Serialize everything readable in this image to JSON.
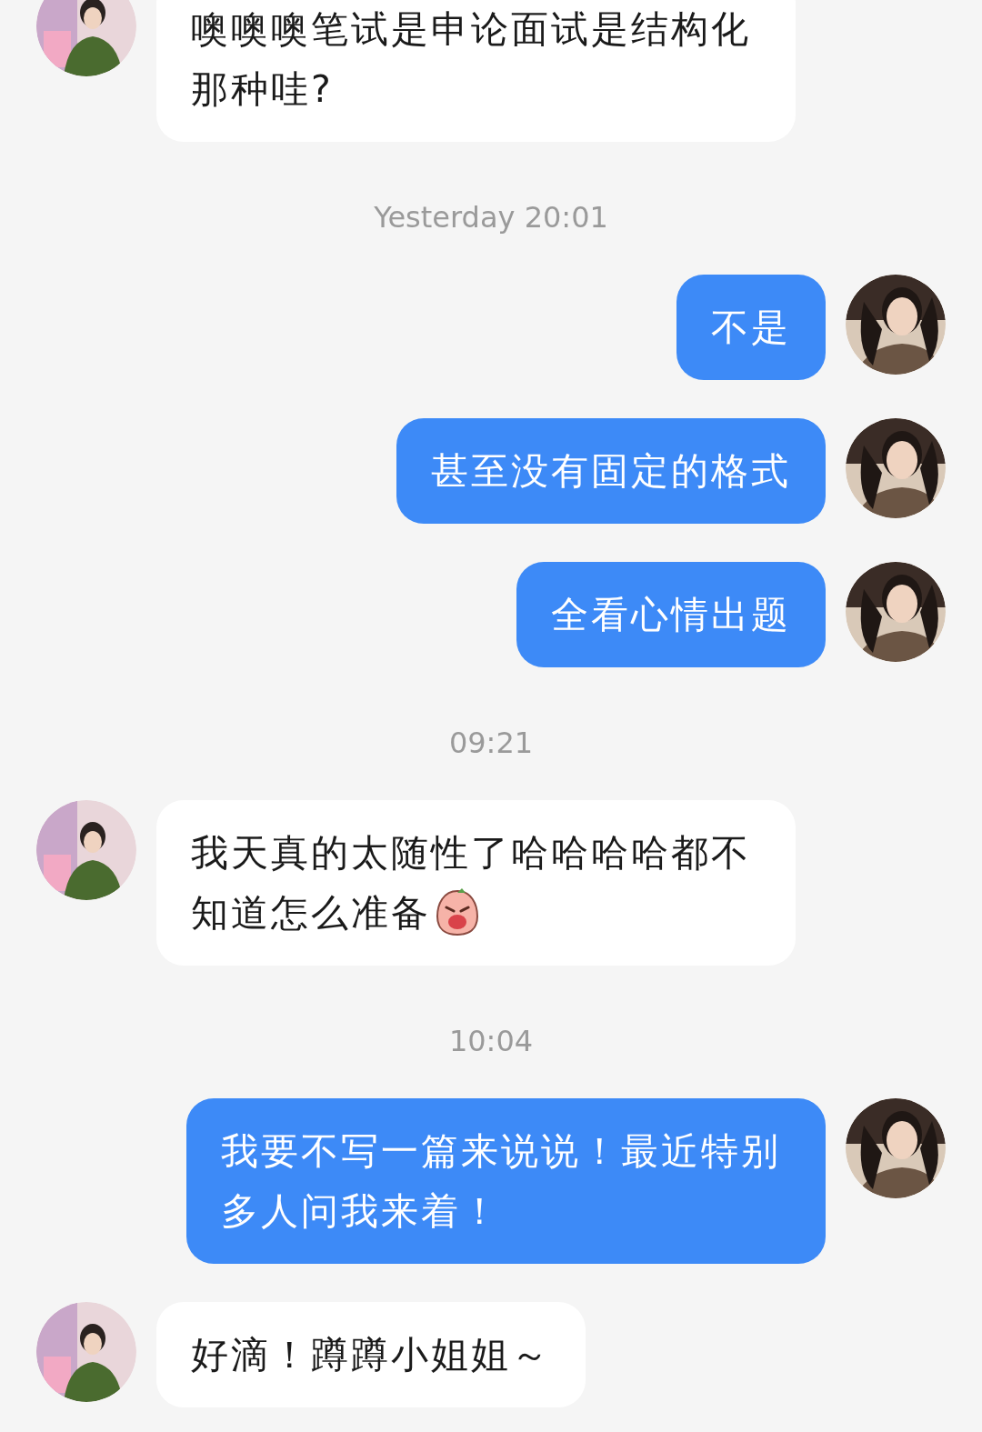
{
  "messages": [
    {
      "kind": "message",
      "outgoing": false,
      "text": "噢噢噢笔试是申论面试是结构化那种哇?",
      "emoji": false
    },
    {
      "kind": "time",
      "text": "Yesterday 20:01"
    },
    {
      "kind": "message",
      "outgoing": true,
      "text": "不是",
      "emoji": false
    },
    {
      "kind": "message",
      "outgoing": true,
      "text": "甚至没有固定的格式",
      "emoji": false
    },
    {
      "kind": "message",
      "outgoing": true,
      "text": "全看心情出题",
      "emoji": false
    },
    {
      "kind": "time",
      "text": "09:21"
    },
    {
      "kind": "message",
      "outgoing": false,
      "text": "我天真的太随性了哈哈哈哈都不知道怎么准备",
      "emoji": true
    },
    {
      "kind": "time",
      "text": "10:04"
    },
    {
      "kind": "message",
      "outgoing": true,
      "text": "我要不写一篇来说说！最近特别多人问我来着！",
      "emoji": false
    },
    {
      "kind": "message",
      "outgoing": false,
      "text": "好滴！蹲蹲小姐姐～",
      "emoji": false
    }
  ]
}
